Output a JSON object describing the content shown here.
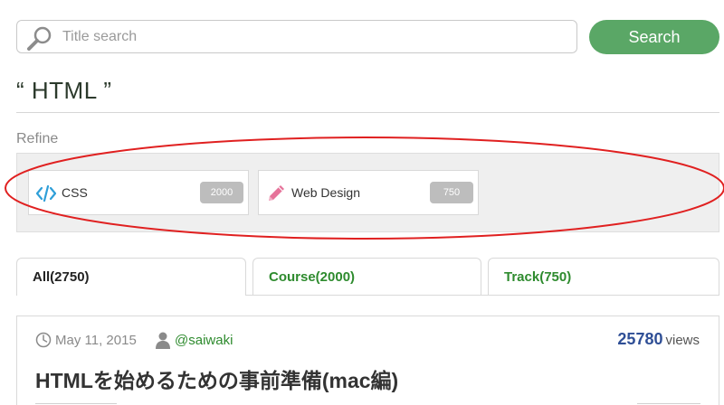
{
  "search": {
    "placeholder": "Title search",
    "value": "",
    "button_label": "Search"
  },
  "query": {
    "title": "“ HTML ”"
  },
  "refine": {
    "label": "Refine",
    "chips": [
      {
        "icon": "code-icon",
        "label": "CSS",
        "count": "2000",
        "icon_color": "#2f9fd8"
      },
      {
        "icon": "pencil-icon",
        "label": "Web Design",
        "count": "750",
        "icon_color": "#e6739a"
      }
    ]
  },
  "tabs": [
    {
      "label": "All(2750)",
      "active": true
    },
    {
      "label": "Course(2000)",
      "active": false
    },
    {
      "label": "Track(750)",
      "active": false
    }
  ],
  "article": {
    "date": "May 11, 2015",
    "author": "@saiwaki",
    "views_count": "25780",
    "views_label": "views",
    "title": "HTMLを始めるための事前準備(mac編)"
  },
  "colors": {
    "accent_green": "#5aa766",
    "link_green": "#2e8b2e",
    "views_blue": "#2f4f96",
    "annotation_red": "#e02020"
  }
}
